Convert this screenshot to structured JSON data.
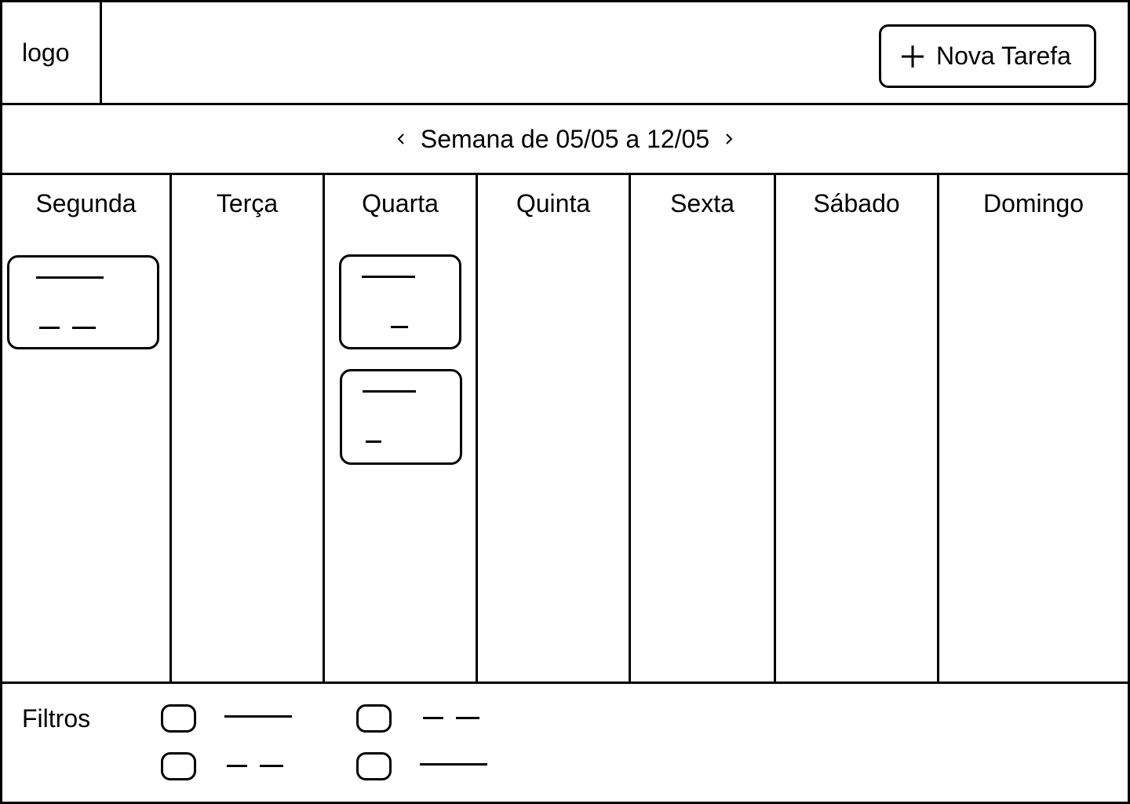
{
  "header": {
    "logo_text": "logo",
    "new_task_label": "Nova Tarefa",
    "new_task_icon": "plus-icon"
  },
  "week_nav": {
    "label": "Semana de 05/05 a 12/05",
    "prev_icon": "chevron-left-icon",
    "next_icon": "chevron-right-icon"
  },
  "days": [
    {
      "name": "Segunda",
      "task_count": 1
    },
    {
      "name": "Terça",
      "task_count": 0
    },
    {
      "name": "Quarta",
      "task_count": 2
    },
    {
      "name": "Quinta",
      "task_count": 0
    },
    {
      "name": "Sexta",
      "task_count": 0
    },
    {
      "name": "Sábado",
      "task_count": 0
    },
    {
      "name": "Domingo",
      "task_count": 0
    }
  ],
  "footer": {
    "filters_label": "Filtros",
    "filter_option_count": 4
  }
}
